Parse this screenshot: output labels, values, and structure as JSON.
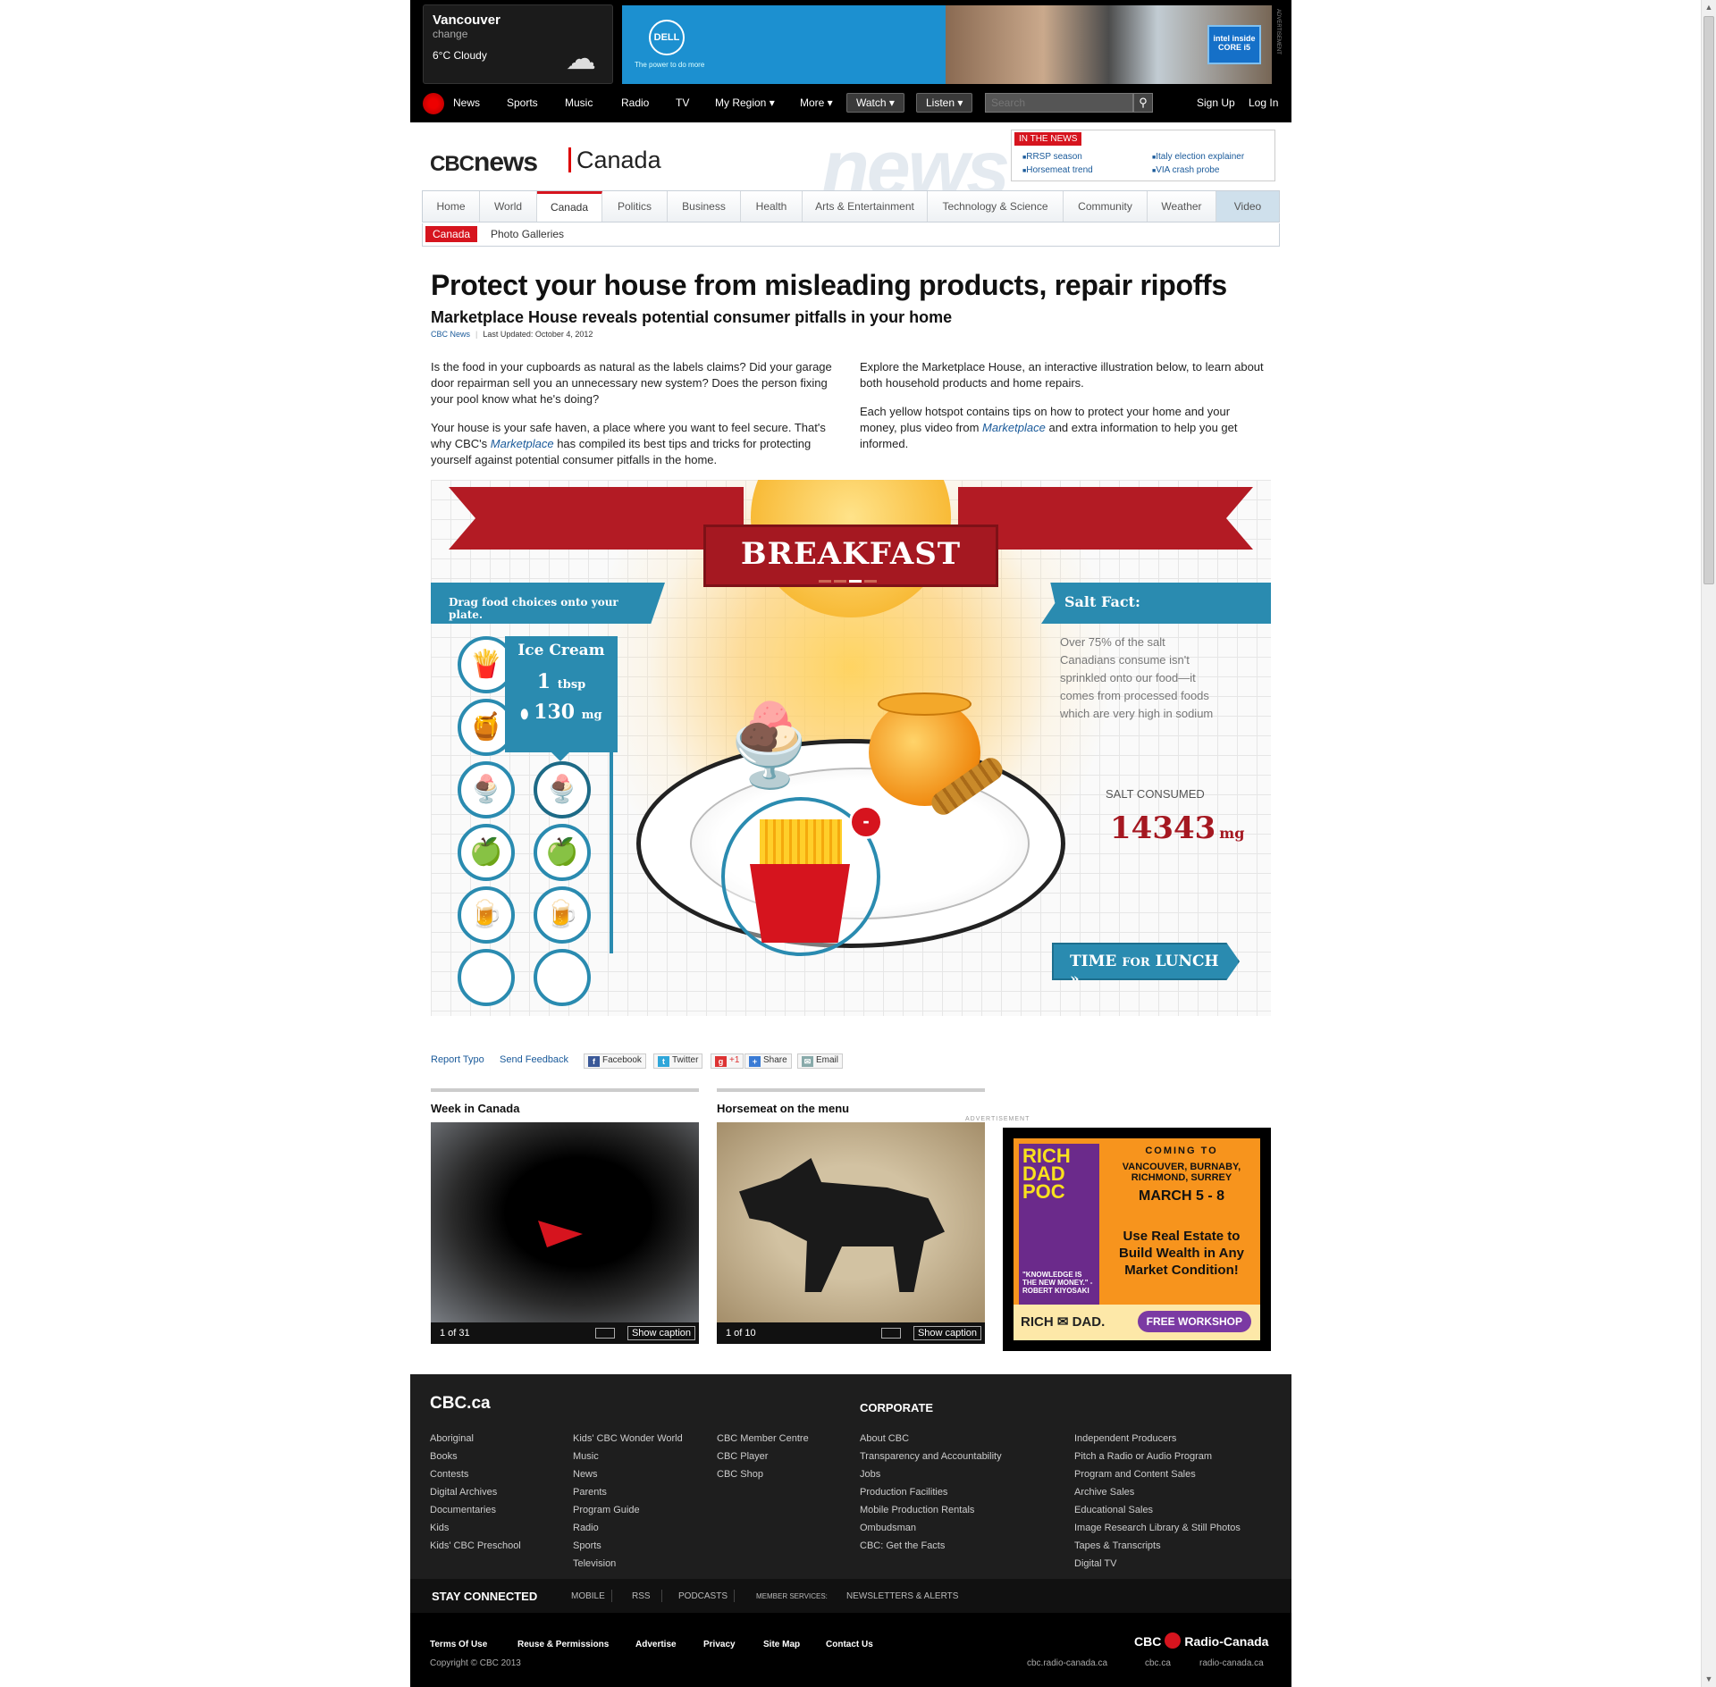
{
  "weather": {
    "city": "Vancouver",
    "change": "change",
    "conditions": "6°C Cloudy"
  },
  "top_ad": {
    "brand": "DELL",
    "tagline": "The power to do more",
    "badge": "intel inside CORE i5",
    "side": "ADVERTISEMENT"
  },
  "main_nav": {
    "items": [
      "News",
      "Sports",
      "Music",
      "Radio",
      "TV",
      "My Region ▾",
      "More ▾"
    ],
    "watch": "Watch ▾",
    "listen": "Listen ▾",
    "search_placeholder": "Search",
    "sign_up": "Sign Up",
    "log_in": "Log In"
  },
  "masthead": {
    "logo_cbc": "CBC",
    "logo_news": "news",
    "section": "Canada",
    "watermark": "news"
  },
  "in_the_news": {
    "header": "IN THE NEWS",
    "items": [
      "RRSP season",
      "Horsemeat trend",
      "Italy election explainer",
      "VIA crash probe"
    ]
  },
  "section_nav": {
    "items": [
      "Home",
      "World",
      "Canada",
      "Politics",
      "Business",
      "Health",
      "Arts & Entertainment",
      "Technology & Science",
      "Community",
      "Weather",
      "Video"
    ],
    "active": "Canada"
  },
  "breadcrumb": {
    "tag": "Canada",
    "link": "Photo Galleries"
  },
  "article": {
    "headline": "Protect your house from misleading products, repair ripoffs",
    "subhead": "Marketplace House reveals potential consumer pitfalls in your home",
    "source": "CBC News",
    "updated": "Last Updated: October 4, 2012",
    "p1": "Is the food in your cupboards as natural as the labels claims? Did your garage door repairman sell you an unnecessary new system? Does the person fixing your pool know what he's doing?",
    "p2_pre": "Your house is your safe haven, a place where you want to feel secure. That's why CBC's ",
    "p2_em": "Marketplace",
    "p2_post": " has compiled its best tips and tricks for protecting yourself against potential consumer pitfalls in the home.",
    "p3": "Explore the Marketplace House, an interactive illustration below, to learn about both household products and home repairs.",
    "p4_pre": "Each yellow hotspot contains tips on how to protect your home and your money, plus video from ",
    "p4_em": "Marketplace",
    "p4_post": " and extra information to help you get informed."
  },
  "game": {
    "title": "BREAKFAST",
    "drag_label": "Drag food choices onto your plate.",
    "salt_fact_title": "Salt Fact:",
    "salt_fact": "Over 75% of the salt Canadians consume isn't sprinkled onto our food—it comes from processed foods which are very high in sodium",
    "salt_consumed_label": "SALT CONSUMED",
    "salt_consumed_value": "14343",
    "salt_unit": "mg",
    "tooltip": {
      "name": "Ice Cream",
      "qty": "1",
      "qty_unit": "tbsp",
      "mg": "130",
      "mg_unit": "mg"
    },
    "next_button_a": "TIME",
    "next_button_b": "FOR",
    "next_button_c": "LUNCH »",
    "food_icons": [
      "🍟",
      "🍯",
      "🍨",
      "🍨",
      "🍏",
      "🍏",
      "🍺",
      "🍺"
    ],
    "remove": "-"
  },
  "share": {
    "report_typo": "Report Typo",
    "send_feedback": "Send Feedback",
    "facebook": "Facebook",
    "twitter": "Twitter",
    "gplus": "+1",
    "share": "Share",
    "email": "Email"
  },
  "galleries": [
    {
      "title": "Week in Canada",
      "count": "1 of 31",
      "caption_btn": "Show caption"
    },
    {
      "title": "Horsemeat on the menu",
      "count": "1 of 10",
      "caption_btn": "Show caption"
    }
  ],
  "ad": {
    "label": "ADVERTISEMENT",
    "book": "RICH DAD POC",
    "coming": "COMING TO",
    "cities": "VANCOUVER, BURNABY, RICHMOND, SURREY",
    "dates": "MARCH 5 - 8",
    "pitch": "Use Real Estate to Build Wealth in Any Market Condition!",
    "quote": "\"KNOWLEDGE IS THE NEW MONEY.\" - ROBERT KIYOSAKI",
    "brand": "RICH ✉ DAD.",
    "cta": "FREE WORKSHOP"
  },
  "footer": {
    "brand": "CBC.ca",
    "corporate": "CORPORATE",
    "col1": [
      "Aboriginal",
      "Books",
      "Contests",
      "Digital Archives",
      "Documentaries",
      "Kids",
      "Kids' CBC Preschool"
    ],
    "col2": [
      "Kids' CBC Wonder World",
      "Music",
      "News",
      "Parents",
      "Program Guide",
      "Radio",
      "Sports",
      "Television"
    ],
    "col3": [
      "CBC Member Centre",
      "CBC Player",
      "CBC Shop"
    ],
    "col4": [
      "About CBC",
      "Transparency and Accountability",
      "Jobs",
      "Production Facilities",
      "Mobile Production Rentals",
      "Ombudsman",
      "CBC: Get the Facts"
    ],
    "col5": [
      "Independent Producers",
      "Pitch a Radio or Audio Program",
      "Program and Content Sales",
      "Archive Sales",
      "Educational Sales",
      "Image Research Library & Still Photos",
      "Tapes & Transcripts",
      "Digital TV"
    ],
    "stay_connected": "STAY CONNECTED",
    "stay_items": [
      "MOBILE",
      "RSS",
      "PODCASTS",
      "MEMBER SERVICES:",
      "NEWSLETTERS & ALERTS"
    ],
    "bottom_links": [
      "Terms Of Use",
      "Reuse & Permissions",
      "Advertise",
      "Privacy",
      "Site Map",
      "Contact Us"
    ],
    "copyright": "Copyright © CBC 2013",
    "crc_left": "CBC",
    "crc_right": "Radio-Canada",
    "domains": [
      "cbc.radio-canada.ca",
      "cbc.ca",
      "radio-canada.ca"
    ]
  }
}
